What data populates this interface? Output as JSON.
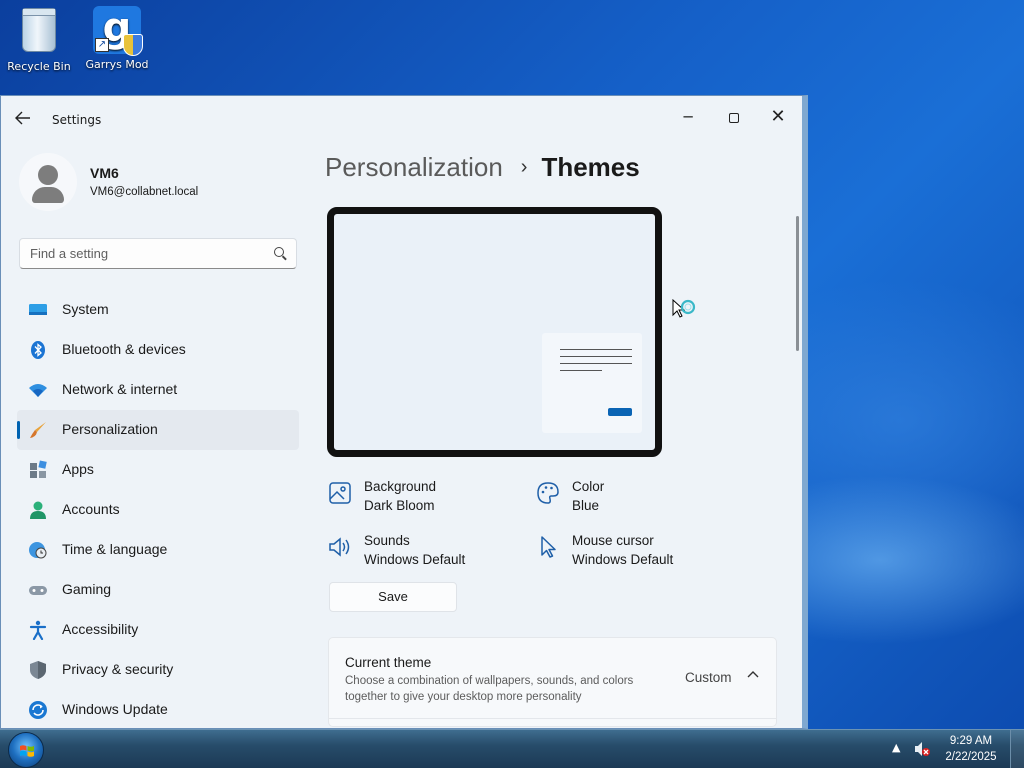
{
  "desktop": {
    "icons": [
      {
        "label": "Recycle Bin",
        "icon": "recycle-bin-icon"
      },
      {
        "label": "Garrys Mod",
        "icon": "garrys-mod-icon",
        "glyph": "g"
      }
    ]
  },
  "window": {
    "title": "Settings",
    "controls": {
      "minimize": "─",
      "close": "✕"
    },
    "user": {
      "name": "VM6",
      "email": "VM6@collabnet.local"
    },
    "search": {
      "placeholder": "Find a setting"
    },
    "nav": [
      {
        "label": "System",
        "icon": "monitor-icon"
      },
      {
        "label": "Bluetooth & devices",
        "icon": "bluetooth-icon"
      },
      {
        "label": "Network & internet",
        "icon": "wifi-icon"
      },
      {
        "label": "Personalization",
        "icon": "paintbrush-icon",
        "active": true
      },
      {
        "label": "Apps",
        "icon": "apps-icon"
      },
      {
        "label": "Accounts",
        "icon": "person-icon"
      },
      {
        "label": "Time & language",
        "icon": "globe-clock-icon"
      },
      {
        "label": "Gaming",
        "icon": "gamepad-icon"
      },
      {
        "label": "Accessibility",
        "icon": "accessibility-icon"
      },
      {
        "label": "Privacy & security",
        "icon": "shield-icon"
      },
      {
        "label": "Windows Update",
        "icon": "update-icon"
      }
    ],
    "breadcrumb": {
      "parent": "Personalization",
      "separator": "›",
      "current": "Themes"
    },
    "properties": {
      "background": {
        "title": "Background",
        "value": "Dark Bloom"
      },
      "color": {
        "title": "Color",
        "value": "Blue"
      },
      "sounds": {
        "title": "Sounds",
        "value": "Windows Default"
      },
      "cursor": {
        "title": "Mouse cursor",
        "value": "Windows Default"
      }
    },
    "save_label": "Save",
    "current_theme": {
      "title": "Current theme",
      "description": "Choose a combination of wallpapers, sounds, and colors together to give your desktop more personality",
      "value": "Custom"
    }
  },
  "taskbar": {
    "tray_arrow": "▲",
    "time": "9:29 AM",
    "date": "2/22/2025"
  },
  "colors": {
    "accent": "#0063b1",
    "window_bg": "#eef3f8",
    "taskbar": "#274c6a"
  }
}
